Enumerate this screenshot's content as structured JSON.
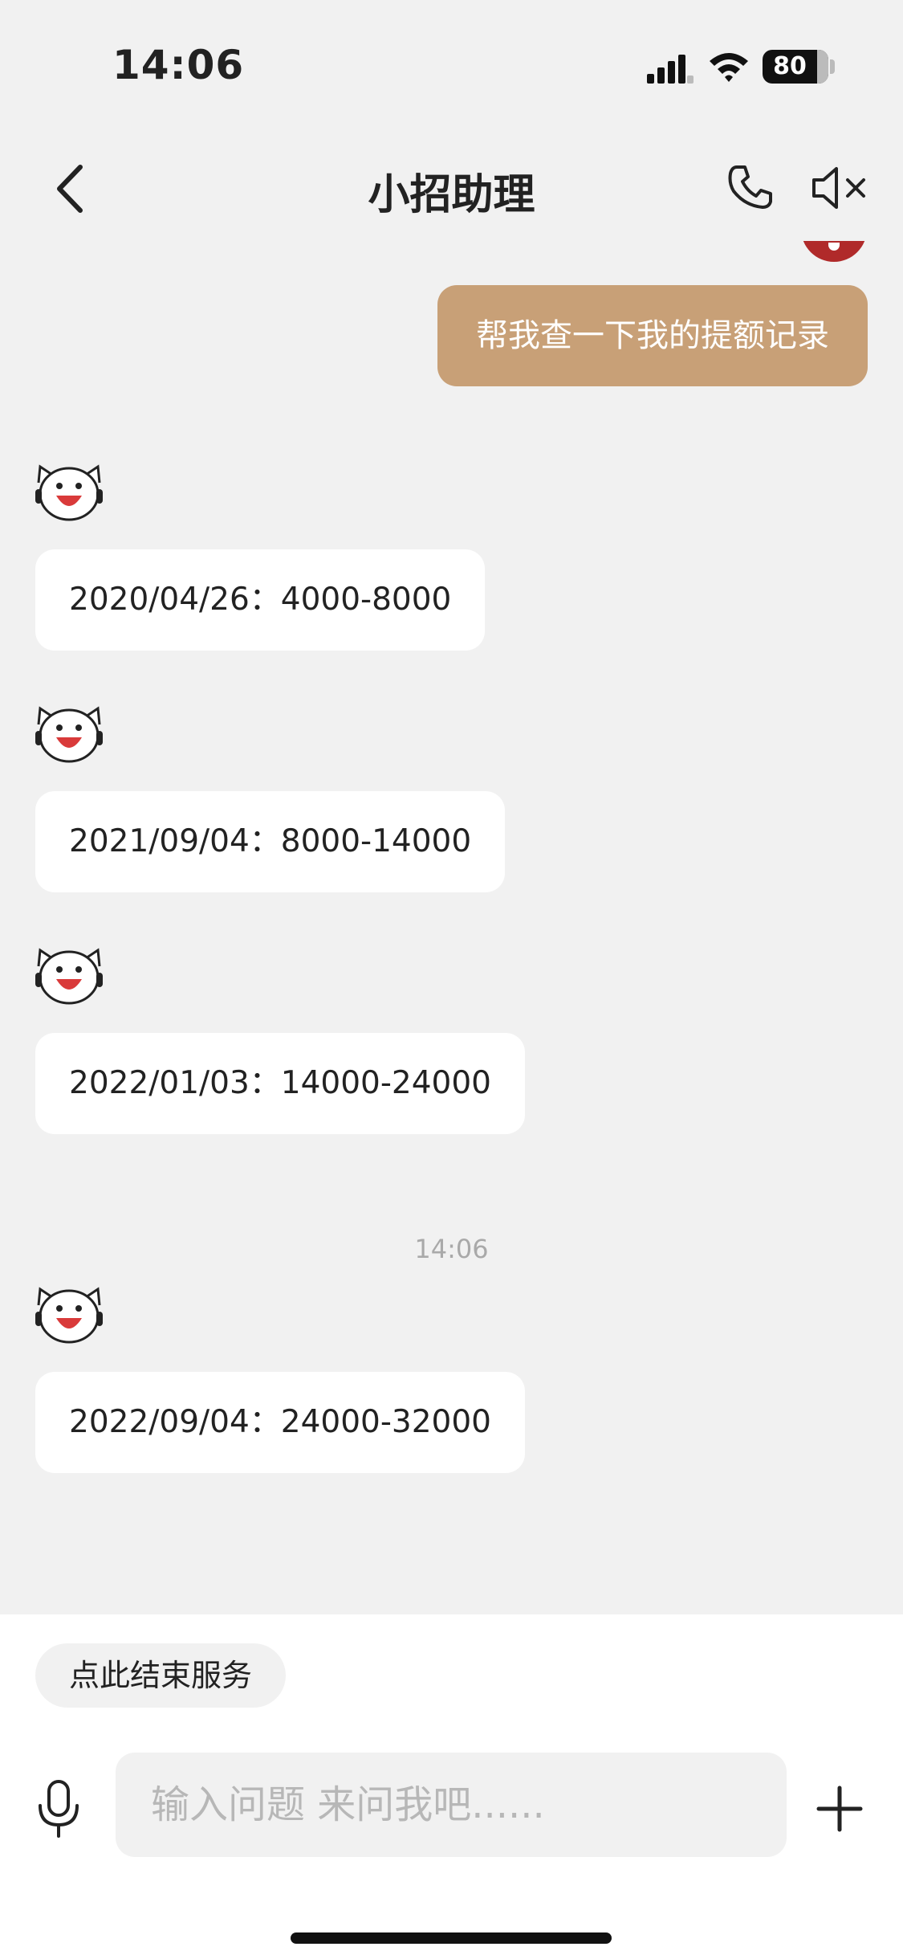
{
  "status_bar": {
    "time": "14:06",
    "battery": "80"
  },
  "header": {
    "title": "小招助理"
  },
  "conversation": {
    "user_message": "帮我查一下我的提额记录",
    "bot_messages": [
      "2020/04/26：4000-8000",
      "2021/09/04：8000-14000",
      "2022/01/03：14000-24000",
      "2022/09/04：24000-32000"
    ],
    "time_divider": "14:06"
  },
  "bottom_bar": {
    "end_service_label": "点此结束服务",
    "input_placeholder": "输入问题 来问我吧......"
  },
  "icons": {
    "back": "chevron-left-icon",
    "call": "phone-icon",
    "mute": "speaker-mute-icon",
    "voice": "microphone-icon",
    "more": "plus-icon",
    "bot": "bot-mascot-icon"
  },
  "colors": {
    "user_bubble": "#c8a077",
    "bot_bubble": "#ffffff",
    "background": "#f1f1f1",
    "mascot_red": "#d93a3a"
  }
}
